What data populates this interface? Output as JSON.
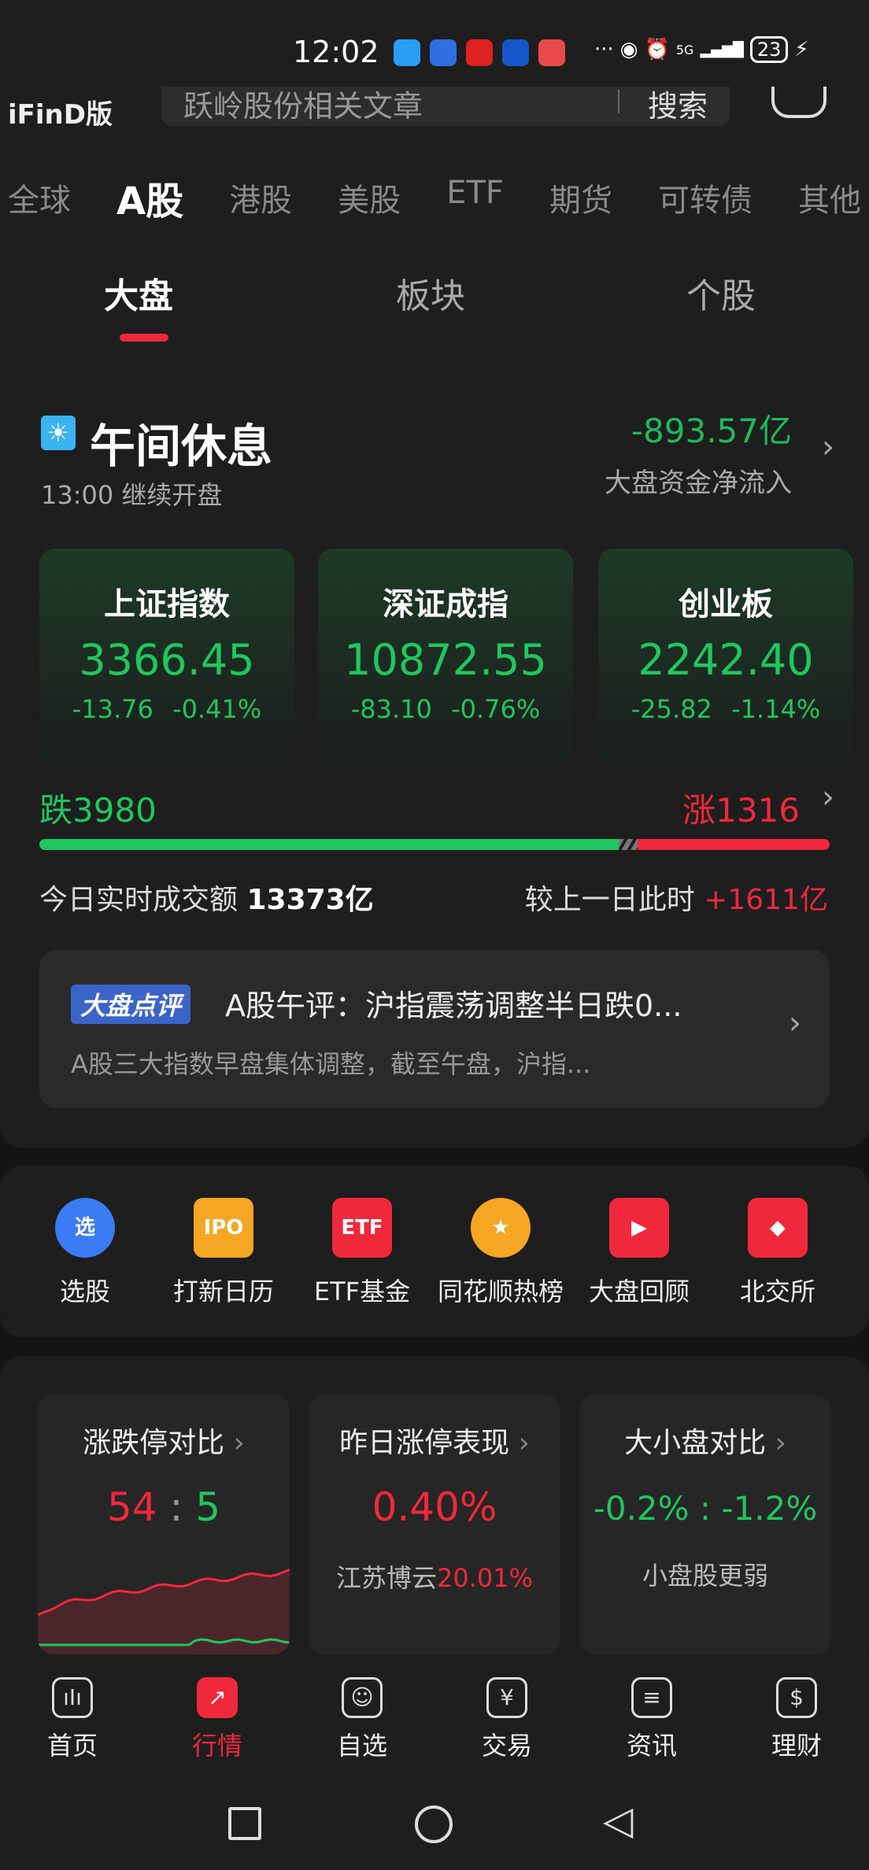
{
  "status": {
    "time": "12:02",
    "network": "5G",
    "battery": "23"
  },
  "header": {
    "logo": "iFinD版",
    "search_placeholder": "跃岭股份相关文章",
    "search_button": "搜索"
  },
  "market_tabs": [
    {
      "label": "全球"
    },
    {
      "label": "A股",
      "active": true
    },
    {
      "label": "港股"
    },
    {
      "label": "美股"
    },
    {
      "label": "ETF"
    },
    {
      "label": "期货"
    },
    {
      "label": "可转债"
    },
    {
      "label": "其他"
    }
  ],
  "sub_tabs": [
    {
      "label": "大盘",
      "active": true
    },
    {
      "label": "板块"
    },
    {
      "label": "个股"
    }
  ],
  "session": {
    "title": "午间休息",
    "subtitle": "13:00 继续开盘",
    "flow_value": "-893.57亿",
    "flow_label": "大盘资金净流入"
  },
  "indices": [
    {
      "name": "上证指数",
      "value": "3366.45",
      "change": "-13.76",
      "pct": "-0.41%"
    },
    {
      "name": "深证成指",
      "value": "10872.55",
      "change": "-83.10",
      "pct": "-0.76%"
    },
    {
      "name": "创业板",
      "value": "2242.40",
      "change": "-25.82",
      "pct": "-1.14%"
    }
  ],
  "breadth": {
    "down_label": "跌3980",
    "up_label": "涨1316",
    "down": 3980,
    "up": 1316,
    "colors": {
      "down": "#1fc75e",
      "up": "#f0283c"
    }
  },
  "turnover": {
    "label": "今日实时成交额",
    "value": "13373亿",
    "compare_label": "较上一日此时",
    "compare_value": "+1611亿"
  },
  "news": {
    "tag": "大盘点评",
    "title": "A股午评：沪指震荡调整半日跌0...",
    "summary": "A股三大指数早盘集体调整，截至午盘，沪指..."
  },
  "shortcuts": [
    {
      "label": "选股",
      "icon": "选",
      "color": "#3b7cf4"
    },
    {
      "label": "打新日历",
      "icon": "IPO",
      "color": "#f5a623"
    },
    {
      "label": "ETF基金",
      "icon": "ETF",
      "color": "#f0283c"
    },
    {
      "label": "同花顺热榜",
      "icon": "★",
      "color": "#f5a623"
    },
    {
      "label": "大盘回顾",
      "icon": "▶",
      "color": "#f0283c"
    },
    {
      "label": "北交所",
      "icon": "◆",
      "color": "#f0283c"
    }
  ],
  "metrics": [
    {
      "title": "涨跌停对比",
      "up": "54",
      "sep": ":",
      "down": "5"
    },
    {
      "title": "昨日涨停表现",
      "value": "0.40%",
      "stock": "江苏博云",
      "stock_pct": "20.01%"
    },
    {
      "title": "大小盘对比",
      "value": "-0.2% : -1.2%",
      "note": "小盘股更弱"
    }
  ],
  "bottom_nav": [
    {
      "label": "首页",
      "icon": "ıIı"
    },
    {
      "label": "行情",
      "icon": "↗",
      "active": true
    },
    {
      "label": "自选",
      "icon": "☺"
    },
    {
      "label": "交易",
      "icon": "¥"
    },
    {
      "label": "资讯",
      "icon": "≡"
    },
    {
      "label": "理财",
      "icon": "$"
    }
  ]
}
